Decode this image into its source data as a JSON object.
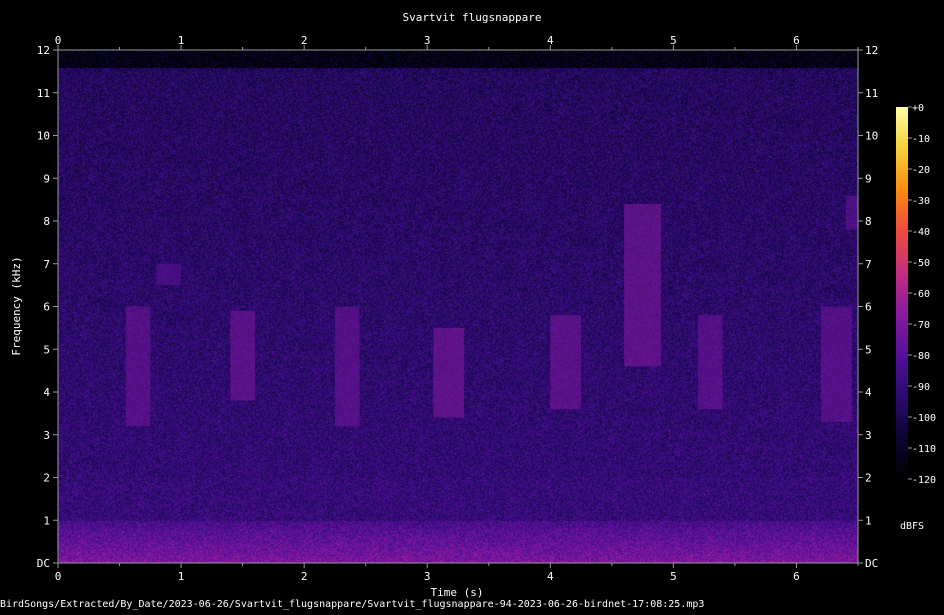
{
  "chart_data": {
    "type": "heatmap",
    "title": "Svartvit flugsnappare",
    "xlabel": "Time (s)",
    "ylabel": "Frequency (kHz)",
    "xlim": [
      0,
      6.5
    ],
    "ylim": [
      0,
      12
    ],
    "x_ticks": [
      "0",
      "1",
      "2",
      "3",
      "4",
      "5",
      "6"
    ],
    "y_ticks": [
      "DC",
      "1",
      "2",
      "3",
      "4",
      "5",
      "6",
      "7",
      "8",
      "9",
      "10",
      "11",
      "12"
    ],
    "colorbar": {
      "label": "dBFS",
      "range": [
        -120,
        0
      ],
      "ticks": [
        "+0",
        "-10",
        "-20",
        "-30",
        "-40",
        "-50",
        "-60",
        "-70",
        "-80",
        "-90",
        "-100",
        "-110",
        "-120"
      ]
    },
    "noise_floor_cutoff_khz": 11.5,
    "events": [
      {
        "t_start": 0.55,
        "t_end": 0.75,
        "f_low": 3.2,
        "f_high": 6.0,
        "level": -72
      },
      {
        "t_start": 0.8,
        "t_end": 1.0,
        "f_low": 6.5,
        "f_high": 7.0,
        "level": -78
      },
      {
        "t_start": 1.4,
        "t_end": 1.6,
        "f_low": 3.8,
        "f_high": 5.9,
        "level": -70
      },
      {
        "t_start": 2.25,
        "t_end": 2.45,
        "f_low": 3.2,
        "f_high": 6.0,
        "level": -72
      },
      {
        "t_start": 3.05,
        "t_end": 3.3,
        "f_low": 3.4,
        "f_high": 5.5,
        "level": -68
      },
      {
        "t_start": 4.0,
        "t_end": 4.25,
        "f_low": 3.6,
        "f_high": 5.8,
        "level": -70
      },
      {
        "t_start": 4.6,
        "t_end": 4.9,
        "f_low": 4.6,
        "f_high": 8.4,
        "level": -68
      },
      {
        "t_start": 5.2,
        "t_end": 5.4,
        "f_low": 3.6,
        "f_high": 5.8,
        "level": -72
      },
      {
        "t_start": 6.2,
        "t_end": 6.45,
        "f_low": 3.3,
        "f_high": 6.0,
        "level": -72
      },
      {
        "t_start": 6.4,
        "t_end": 6.5,
        "f_low": 7.8,
        "f_high": 8.6,
        "level": -74
      }
    ]
  },
  "footer": {
    "file_path": "BirdSongs/Extracted/By_Date/2023-06-26/Svartvit_flugsnappare/Svartvit_flugsnappare-94-2023-06-26-birdnet-17:08:25.mp3"
  },
  "colors": {
    "background": "#000000",
    "axis": "#aaaaaa",
    "text": "#ffffff",
    "colormap": [
      "#000000",
      "#0d0433",
      "#2a0b6e",
      "#55109a",
      "#8a1a9e",
      "#c42e7e",
      "#ee4a3c",
      "#fb8b12",
      "#f7cf3a",
      "#fcffa4"
    ]
  }
}
